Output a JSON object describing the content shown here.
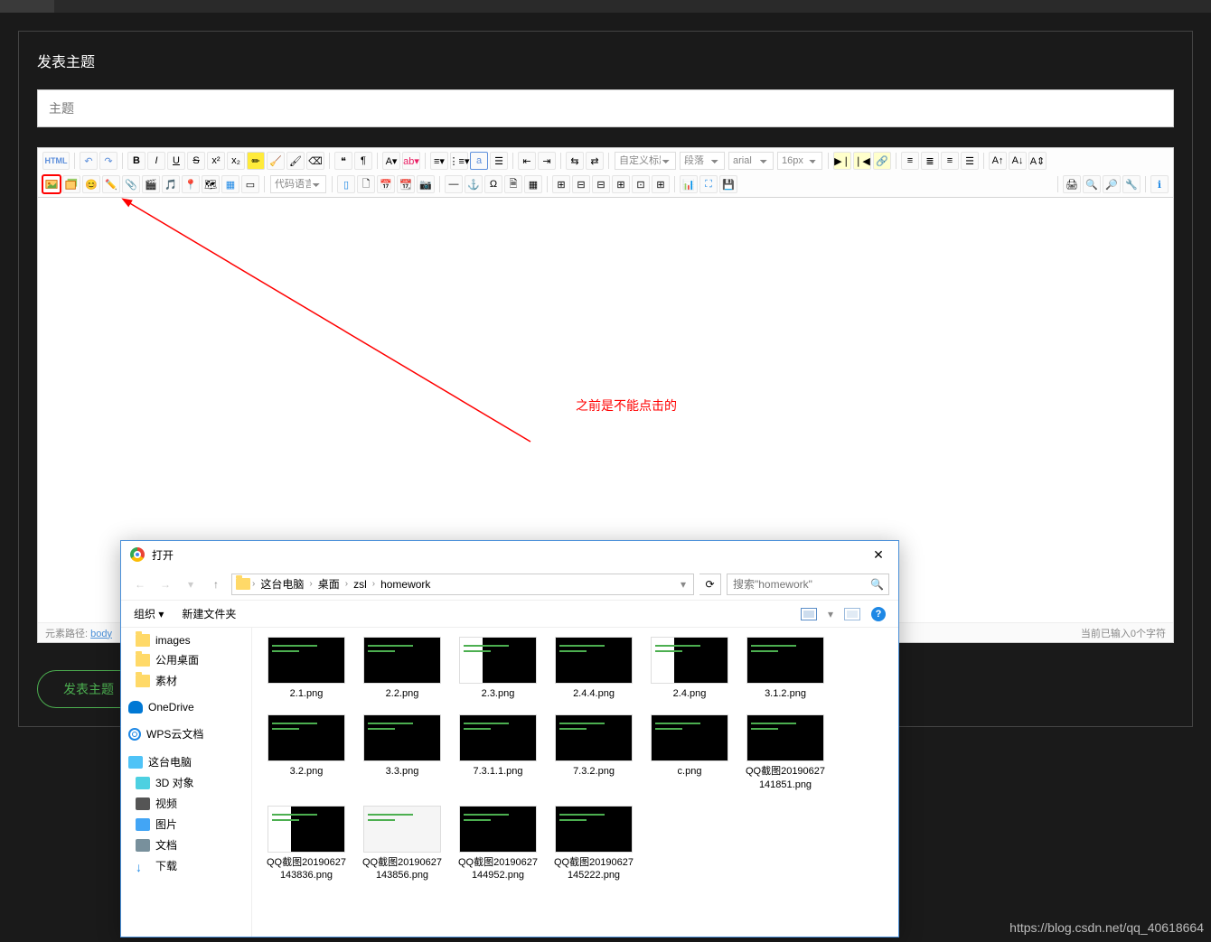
{
  "page": {
    "title": "发表主题",
    "subject_placeholder": "主题",
    "annotation": "之前是不能点击的",
    "footer_prefix": "元素路径: ",
    "footer_link": "body",
    "footer_right": "当前已输入0个字符",
    "publish_button": "发表主题",
    "watermark": "https://blog.csdn.net/qq_40618664"
  },
  "toolbar": {
    "html": "HTML",
    "custom_title": "自定义标题",
    "paragraph": "段落",
    "font_family": "arial",
    "font_size": "16px",
    "code_lang": "代码语言"
  },
  "dialog": {
    "title": "打开",
    "path": [
      "这台电脑",
      "桌面",
      "zsl",
      "homework"
    ],
    "search_placeholder": "搜索\"homework\"",
    "organize": "组织",
    "new_folder": "新建文件夹",
    "sidebar": [
      {
        "id": "images",
        "label": "images",
        "icon": "folder"
      },
      {
        "id": "shared-desktop",
        "label": "公用桌面",
        "icon": "folder"
      },
      {
        "id": "materials",
        "label": "素材",
        "icon": "folder"
      },
      {
        "id": "onedrive",
        "label": "OneDrive",
        "icon": "onedrive"
      },
      {
        "id": "wps",
        "label": "WPS云文档",
        "icon": "wps"
      },
      {
        "id": "this-pc",
        "label": "这台电脑",
        "icon": "pc"
      },
      {
        "id": "3d",
        "label": "3D 对象",
        "icon": "3d"
      },
      {
        "id": "video",
        "label": "视频",
        "icon": "video"
      },
      {
        "id": "pictures",
        "label": "图片",
        "icon": "pic"
      },
      {
        "id": "docs",
        "label": "文档",
        "icon": "doc"
      },
      {
        "id": "downloads",
        "label": "下载",
        "icon": "dl"
      }
    ],
    "files": [
      {
        "name": "2.1.png",
        "thumb": "dark"
      },
      {
        "name": "2.2.png",
        "thumb": "dark"
      },
      {
        "name": "2.3.png",
        "thumb": "mixed"
      },
      {
        "name": "2.4.4.png",
        "thumb": "dark"
      },
      {
        "name": "2.4.png",
        "thumb": "mixed"
      },
      {
        "name": "3.1.2.png",
        "thumb": "dark"
      },
      {
        "name": "3.2.png",
        "thumb": "dark"
      },
      {
        "name": "3.3.png",
        "thumb": "dark"
      },
      {
        "name": "7.3.1.1.png",
        "thumb": "dark"
      },
      {
        "name": "7.3.2.png",
        "thumb": "dark"
      },
      {
        "name": "c.png",
        "thumb": "dark"
      },
      {
        "name": "QQ截图20190627141851.png",
        "thumb": "dark"
      },
      {
        "name": "QQ截图20190627143836.png",
        "thumb": "mixed"
      },
      {
        "name": "QQ截图20190627143856.png",
        "thumb": "light"
      },
      {
        "name": "QQ截图20190627144952.png",
        "thumb": "dark"
      },
      {
        "name": "QQ截图20190627145222.png",
        "thumb": "dark"
      }
    ]
  }
}
